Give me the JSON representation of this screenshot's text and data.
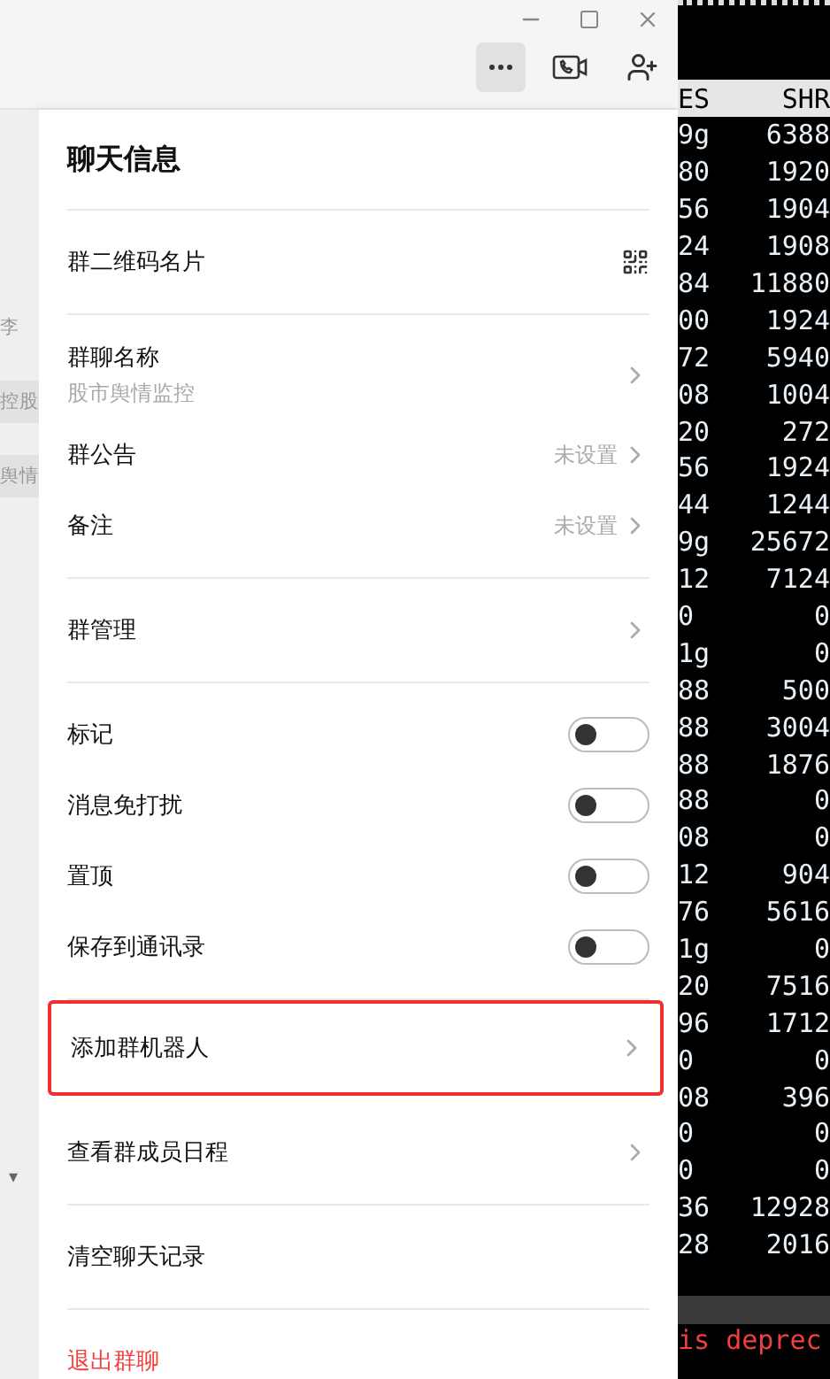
{
  "sidebar": {
    "items": [
      {
        "label": "李",
        "selected": false
      },
      {
        "label": "控股",
        "selected": true
      },
      {
        "label": "舆情",
        "selected": true
      }
    ],
    "dropdown": "▾"
  },
  "panel": {
    "title": "聊天信息",
    "sections": [
      {
        "items": [
          {
            "kind": "qr",
            "label": "群二维码名片"
          }
        ]
      },
      {
        "items": [
          {
            "kind": "link",
            "label": "群聊名称",
            "subtitle": "股市舆情监控"
          },
          {
            "kind": "link",
            "label": "群公告",
            "value": "未设置"
          },
          {
            "kind": "link",
            "label": "备注",
            "value": "未设置"
          }
        ]
      },
      {
        "items": [
          {
            "kind": "link",
            "label": "群管理"
          }
        ]
      },
      {
        "items": [
          {
            "kind": "toggle",
            "label": "标记",
            "on": false
          },
          {
            "kind": "toggle",
            "label": "消息免打扰",
            "on": false
          },
          {
            "kind": "toggle",
            "label": "置顶",
            "on": false
          },
          {
            "kind": "toggle",
            "label": "保存到通讯录",
            "on": false
          }
        ]
      },
      {
        "items": [
          {
            "kind": "link",
            "label": "添加群机器人",
            "highlighted": true
          },
          {
            "kind": "link",
            "label": "查看群成员日程",
            "highlighted": false
          }
        ]
      },
      {
        "items": [
          {
            "kind": "plain",
            "label": "清空聊天记录"
          }
        ]
      },
      {
        "items": [
          {
            "kind": "danger",
            "label": "退出群聊"
          }
        ]
      }
    ]
  },
  "terminal": {
    "columns": [
      "ES",
      "SHR"
    ],
    "rows": [
      [
        "9g",
        "6388"
      ],
      [
        "80",
        "1920"
      ],
      [
        "56",
        "1904"
      ],
      [
        "24",
        "1908"
      ],
      [
        "84",
        "11880"
      ],
      [
        "00",
        "1924"
      ],
      [
        "72",
        "5940"
      ],
      [
        "08",
        "1004"
      ],
      [
        "20",
        "272"
      ],
      [
        "56",
        "1924"
      ],
      [
        "44",
        "1244"
      ],
      [
        "9g",
        "25672"
      ],
      [
        "12",
        "7124"
      ],
      [
        "0",
        "0"
      ],
      [
        "1g",
        "0"
      ],
      [
        "88",
        "500"
      ],
      [
        "88",
        "3004"
      ],
      [
        "88",
        "1876"
      ],
      [
        "88",
        "0"
      ],
      [
        "08",
        "0"
      ],
      [
        "12",
        "904"
      ],
      [
        "76",
        "5616"
      ],
      [
        "1g",
        "0"
      ],
      [
        "20",
        "7516"
      ],
      [
        "96",
        "1712"
      ],
      [
        "0",
        "0"
      ],
      [
        "08",
        "396"
      ],
      [
        "0",
        "0"
      ],
      [
        "0",
        "0"
      ],
      [
        "36",
        "12928"
      ],
      [
        "28",
        "2016"
      ]
    ],
    "warning": "is deprec"
  }
}
